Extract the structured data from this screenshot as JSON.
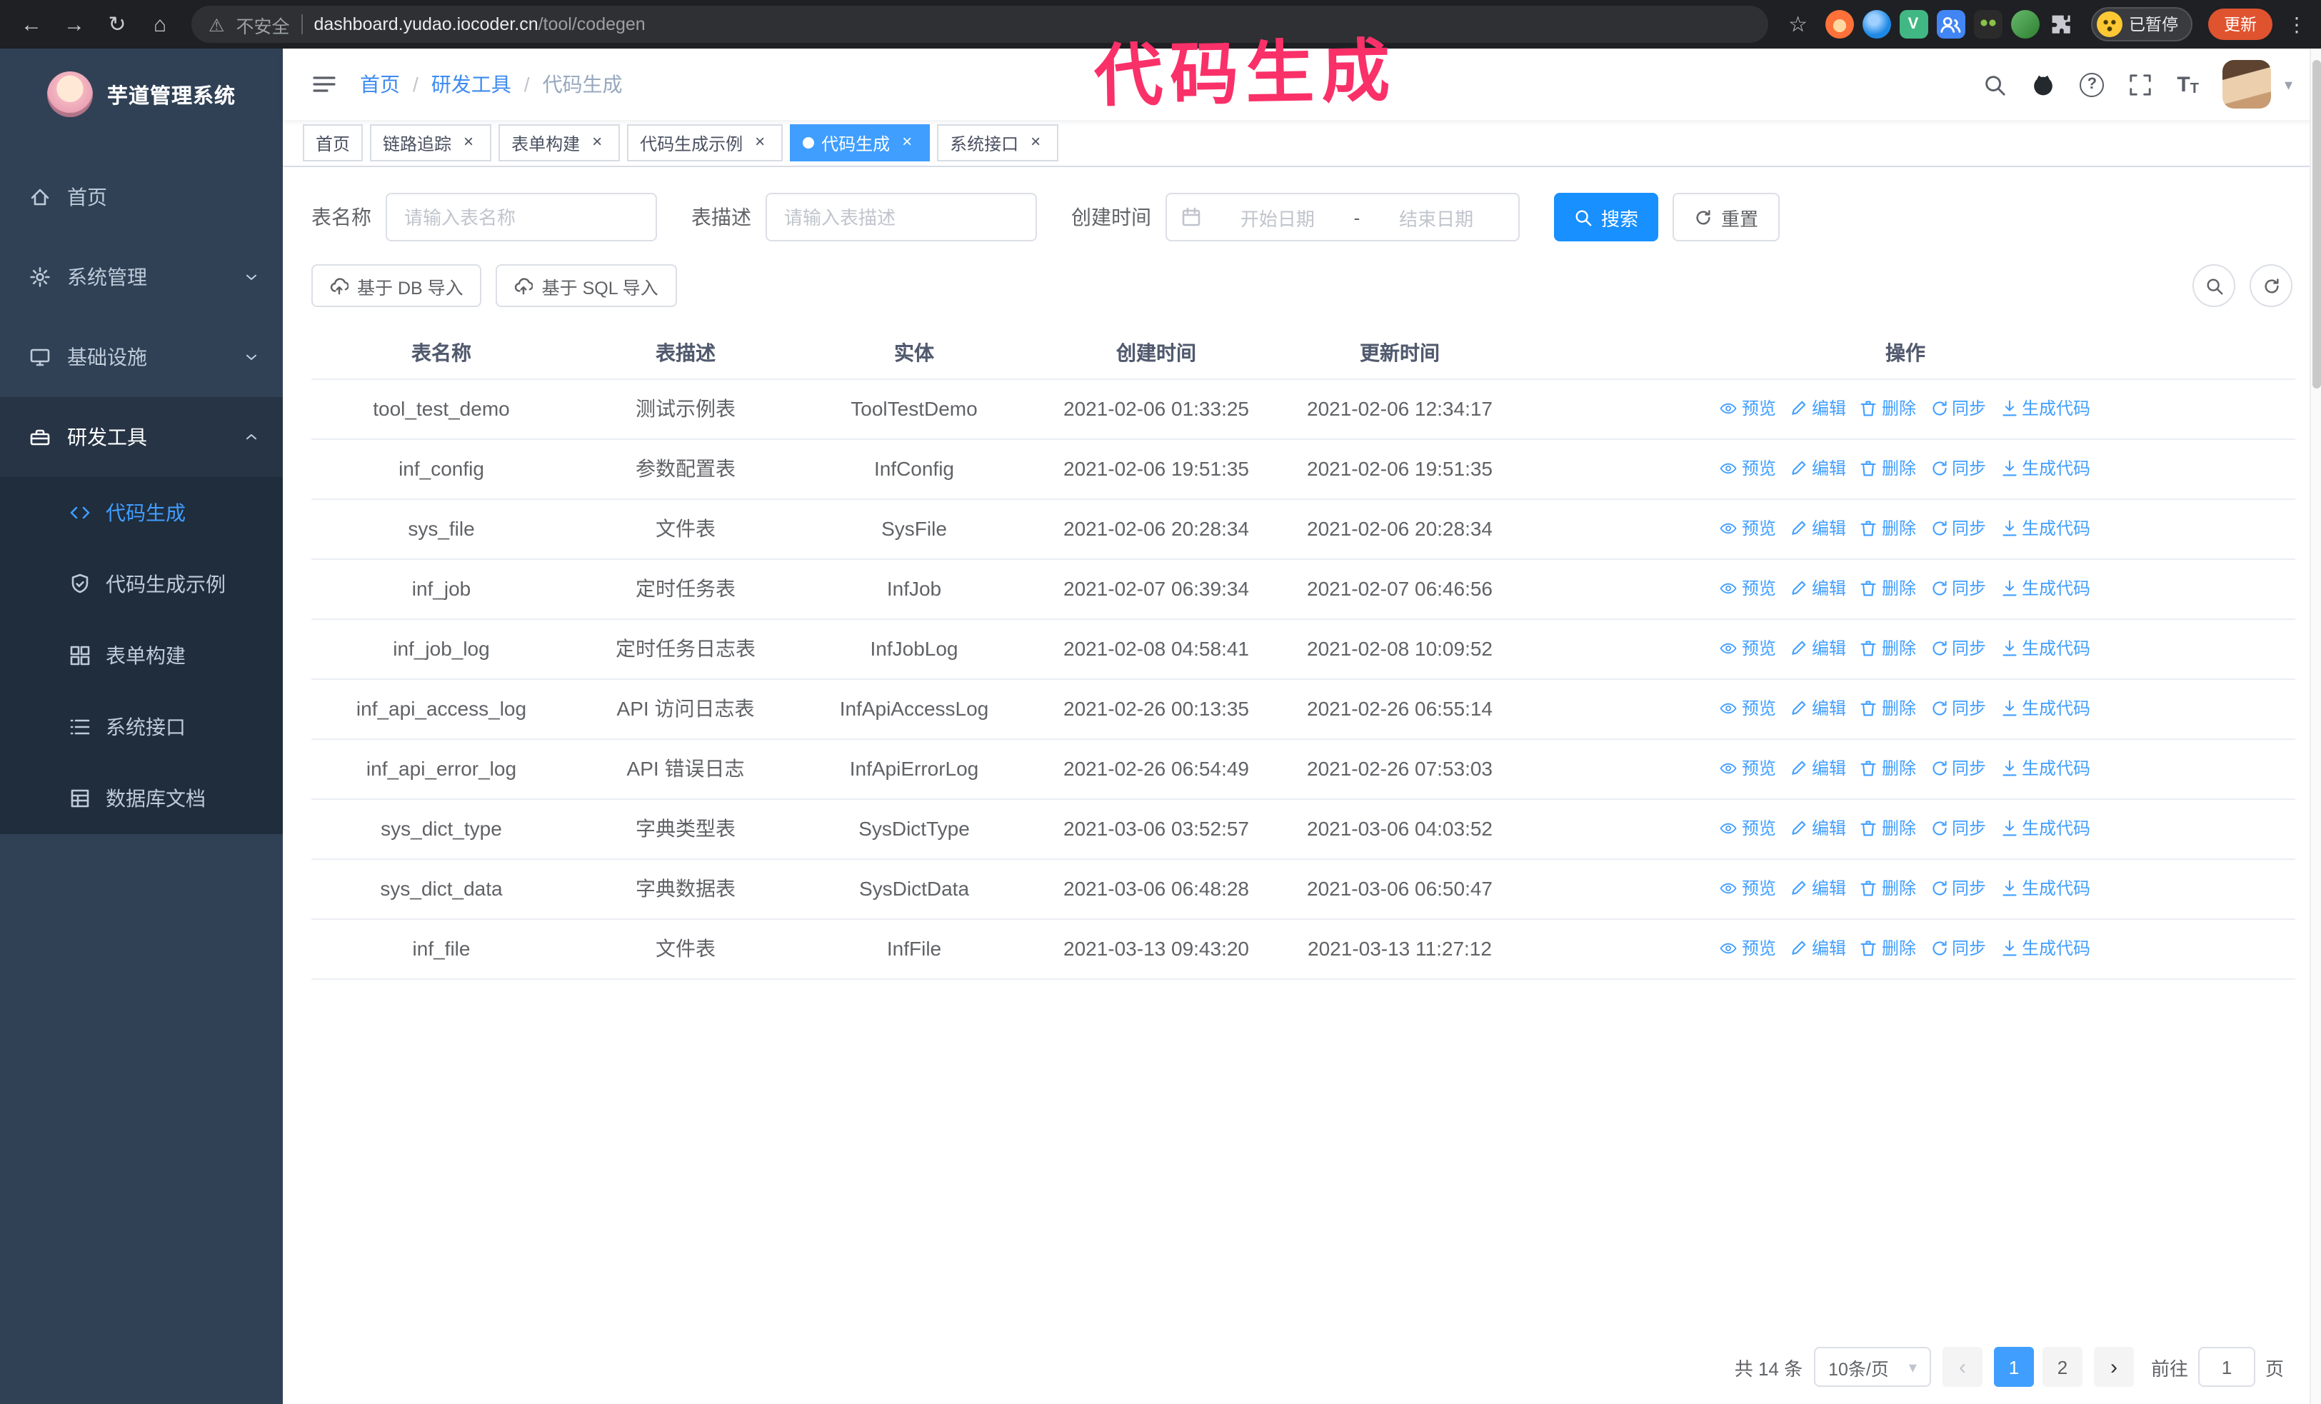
{
  "colors": {
    "accent": "#409eff",
    "primary_button": "#1890ff",
    "sidebar_bg": "#304156",
    "submenu_bg": "#1f2d3d",
    "overlay_text": "#fa3069",
    "tab_active": "#409eff",
    "update_button": "#e0532f"
  },
  "overlay": {
    "title": "代码生成"
  },
  "glyphs": {
    "back": "←",
    "forward": "→",
    "reload": "↻",
    "home": "⌂",
    "warning": "⚠",
    "star": "☆",
    "kebab": "⋮",
    "caret_down": "▾",
    "close": "×",
    "prev": "‹",
    "next": "›",
    "question": "?",
    "font_size_big": "T",
    "font_size_small": "T",
    "vue_letter": "V"
  },
  "browser": {
    "security_label": "不安全",
    "url_host": "dashboard.yudao.iocoder.cn",
    "url_path": "/tool/codegen",
    "paused_badge": "已暂停",
    "update_button": "更新",
    "extension_icons": [
      "fox-icon",
      "droplet-icon",
      "vue-devtools-icon",
      "contacts-icon",
      "monkey-icon",
      "leaf-icon",
      "puzzle-icon"
    ]
  },
  "sidebar": {
    "logo_title": "芋道管理系统",
    "items": [
      {
        "label": "首页",
        "icon": "home-icon"
      },
      {
        "label": "系统管理",
        "icon": "gear-icon",
        "expandable": true
      },
      {
        "label": "基础设施",
        "icon": "monitor-icon",
        "expandable": true
      },
      {
        "label": "研发工具",
        "icon": "toolbox-icon",
        "expandable": true,
        "expanded": true
      }
    ],
    "sub_items": [
      {
        "label": "代码生成",
        "icon": "code-icon",
        "active": true
      },
      {
        "label": "代码生成示例",
        "icon": "shield-check-icon"
      },
      {
        "label": "表单构建",
        "icon": "form-grid-icon"
      },
      {
        "label": "系统接口",
        "icon": "api-list-icon"
      },
      {
        "label": "数据库文档",
        "icon": "db-doc-icon"
      }
    ]
  },
  "header": {
    "breadcrumb": [
      "首页",
      "研发工具",
      "代码生成"
    ],
    "separator": "/",
    "right_icons": [
      "search-icon",
      "github-icon",
      "question-icon",
      "fullscreen-icon",
      "font-size-icon",
      "avatar"
    ]
  },
  "tabs": [
    {
      "label": "首页",
      "closable": false,
      "active": false
    },
    {
      "label": "链路追踪",
      "closable": true,
      "active": false
    },
    {
      "label": "表单构建",
      "closable": true,
      "active": false
    },
    {
      "label": "代码生成示例",
      "closable": true,
      "active": false
    },
    {
      "label": "代码生成",
      "closable": true,
      "active": true
    },
    {
      "label": "系统接口",
      "closable": true,
      "active": false
    }
  ],
  "filters": {
    "table_name_label": "表名称",
    "table_name_placeholder": "请输入表名称",
    "table_desc_label": "表描述",
    "table_desc_placeholder": "请输入表描述",
    "create_time_label": "创建时间",
    "date_start_placeholder": "开始日期",
    "date_separator": "-",
    "date_end_placeholder": "结束日期",
    "search_button": "搜索",
    "reset_button": "重置"
  },
  "toolbar": {
    "import_db_button": "基于 DB 导入",
    "import_sql_button": "基于 SQL 导入"
  },
  "table": {
    "columns": [
      "表名称",
      "表描述",
      "实体",
      "创建时间",
      "更新时间",
      "操作"
    ],
    "actions": [
      "预览",
      "编辑",
      "删除",
      "同步",
      "生成代码"
    ],
    "rows": [
      {
        "name": "tool_test_demo",
        "desc": "测试示例表",
        "entity": "ToolTestDemo",
        "created": "2021-02-06 01:33:25",
        "updated": "2021-02-06 12:34:17"
      },
      {
        "name": "inf_config",
        "desc": "参数配置表",
        "entity": "InfConfig",
        "created": "2021-02-06 19:51:35",
        "updated": "2021-02-06 19:51:35"
      },
      {
        "name": "sys_file",
        "desc": "文件表",
        "entity": "SysFile",
        "created": "2021-02-06 20:28:34",
        "updated": "2021-02-06 20:28:34"
      },
      {
        "name": "inf_job",
        "desc": "定时任务表",
        "entity": "InfJob",
        "created": "2021-02-07 06:39:34",
        "updated": "2021-02-07 06:46:56"
      },
      {
        "name": "inf_job_log",
        "desc": "定时任务日志表",
        "entity": "InfJobLog",
        "created": "2021-02-08 04:58:41",
        "updated": "2021-02-08 10:09:52"
      },
      {
        "name": "inf_api_access_log",
        "desc": "API 访问日志表",
        "entity": "InfApiAccessLog",
        "created": "2021-02-26 00:13:35",
        "updated": "2021-02-26 06:55:14"
      },
      {
        "name": "inf_api_error_log",
        "desc": "API 错误日志",
        "entity": "InfApiErrorLog",
        "created": "2021-02-26 06:54:49",
        "updated": "2021-02-26 07:53:03"
      },
      {
        "name": "sys_dict_type",
        "desc": "字典类型表",
        "entity": "SysDictType",
        "created": "2021-03-06 03:52:57",
        "updated": "2021-03-06 04:03:52"
      },
      {
        "name": "sys_dict_data",
        "desc": "字典数据表",
        "entity": "SysDictData",
        "created": "2021-03-06 06:48:28",
        "updated": "2021-03-06 06:50:47"
      },
      {
        "name": "inf_file",
        "desc": "文件表",
        "entity": "InfFile",
        "created": "2021-03-13 09:43:20",
        "updated": "2021-03-13 11:27:12"
      }
    ]
  },
  "pagination": {
    "total_text": "共 14 条",
    "page_size_value": "10条/页",
    "pages": [
      "1",
      "2"
    ],
    "active_page": "1",
    "goto_label": "前往",
    "goto_value": "1",
    "goto_suffix": "页"
  }
}
